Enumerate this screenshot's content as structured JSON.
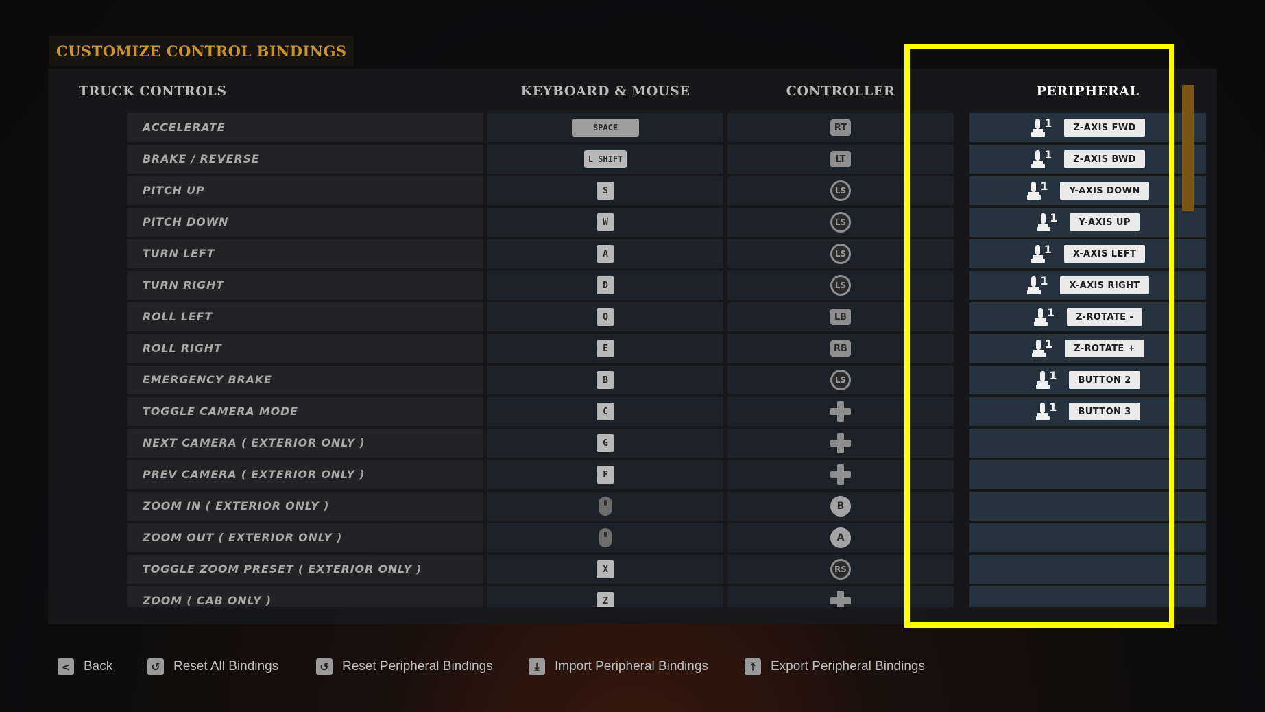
{
  "title": "CUSTOMIZE CONTROL BINDINGS",
  "headers": {
    "controls": "TRUCK CONTROLS",
    "keyboard": "KEYBOARD & MOUSE",
    "controller": "CONTROLLER",
    "peripheral": "PERIPHERAL"
  },
  "rows": [
    {
      "name": "ACCELERATE",
      "kb": {
        "type": "key-wide",
        "label": "SPACE"
      },
      "ctl": {
        "type": "pad",
        "label": "RT"
      },
      "per": {
        "device": "1",
        "label": "Z-AXIS FWD"
      }
    },
    {
      "name": "BRAKE / REVERSE",
      "kb": {
        "type": "key-mid",
        "label": "L SHIFT"
      },
      "ctl": {
        "type": "pad",
        "label": "LT"
      },
      "per": {
        "device": "1",
        "label": "Z-AXIS BWD"
      }
    },
    {
      "name": "PITCH UP",
      "kb": {
        "type": "key",
        "label": "S"
      },
      "ctl": {
        "type": "stick",
        "label": "LS"
      },
      "per": {
        "device": "1",
        "label": "Y-AXIS DOWN"
      }
    },
    {
      "name": "PITCH DOWN",
      "kb": {
        "type": "key",
        "label": "W"
      },
      "ctl": {
        "type": "stick",
        "label": "LS"
      },
      "per": {
        "device": "1",
        "label": "Y-AXIS UP"
      }
    },
    {
      "name": "TURN LEFT",
      "kb": {
        "type": "key",
        "label": "A"
      },
      "ctl": {
        "type": "stick",
        "label": "LS"
      },
      "per": {
        "device": "1",
        "label": "X-AXIS LEFT"
      }
    },
    {
      "name": "TURN RIGHT",
      "kb": {
        "type": "key",
        "label": "D"
      },
      "ctl": {
        "type": "stick",
        "label": "LS"
      },
      "per": {
        "device": "1",
        "label": "X-AXIS RIGHT"
      }
    },
    {
      "name": "ROLL LEFT",
      "kb": {
        "type": "key",
        "label": "Q"
      },
      "ctl": {
        "type": "pad",
        "label": "LB"
      },
      "per": {
        "device": "1",
        "label": "Z-ROTATE -"
      }
    },
    {
      "name": "ROLL RIGHT",
      "kb": {
        "type": "key",
        "label": "E"
      },
      "ctl": {
        "type": "pad",
        "label": "RB"
      },
      "per": {
        "device": "1",
        "label": "Z-ROTATE +"
      }
    },
    {
      "name": "EMERGENCY BRAKE",
      "kb": {
        "type": "key",
        "label": "B"
      },
      "ctl": {
        "type": "stick",
        "label": "LS"
      },
      "per": {
        "device": "1",
        "label": "BUTTON 2"
      }
    },
    {
      "name": "TOGGLE CAMERA MODE",
      "kb": {
        "type": "key",
        "label": "C"
      },
      "ctl": {
        "type": "dpad",
        "label": ""
      },
      "per": {
        "device": "1",
        "label": "BUTTON 3"
      }
    },
    {
      "name": "NEXT CAMERA ( EXTERIOR ONLY )",
      "kb": {
        "type": "key",
        "label": "G"
      },
      "ctl": {
        "type": "dpad",
        "label": ""
      },
      "per": null
    },
    {
      "name": "PREV CAMERA ( EXTERIOR ONLY )",
      "kb": {
        "type": "key",
        "label": "F"
      },
      "ctl": {
        "type": "dpad",
        "label": ""
      },
      "per": null
    },
    {
      "name": "ZOOM IN ( EXTERIOR ONLY )",
      "kb": {
        "type": "mouse",
        "label": ""
      },
      "ctl": {
        "type": "face",
        "label": "B"
      },
      "per": null
    },
    {
      "name": "ZOOM OUT ( EXTERIOR ONLY )",
      "kb": {
        "type": "mouse",
        "label": ""
      },
      "ctl": {
        "type": "face",
        "label": "A"
      },
      "per": null
    },
    {
      "name": "TOGGLE ZOOM PRESET ( EXTERIOR ONLY )",
      "kb": {
        "type": "key",
        "label": "X"
      },
      "ctl": {
        "type": "stick",
        "label": "RS"
      },
      "per": null
    },
    {
      "name": "ZOOM ( CAB ONLY )",
      "kb": {
        "type": "key",
        "label": "Z"
      },
      "ctl": {
        "type": "dpad",
        "label": ""
      },
      "per": null
    }
  ],
  "footer": [
    {
      "icon": "back-icon",
      "glyph": "<",
      "label": "Back"
    },
    {
      "icon": "reset-icon",
      "glyph": "↺",
      "label": "Reset All Bindings"
    },
    {
      "icon": "reset-icon",
      "glyph": "↺",
      "label": "Reset Peripheral Bindings"
    },
    {
      "icon": "import-icon",
      "glyph": "⤓",
      "label": "Import Peripheral Bindings"
    },
    {
      "icon": "export-icon",
      "glyph": "⤒",
      "label": "Export Peripheral Bindings"
    }
  ],
  "colors": {
    "accent": "#c8922e",
    "highlight": "#ffff00",
    "scrollbar": "#7a5518"
  }
}
